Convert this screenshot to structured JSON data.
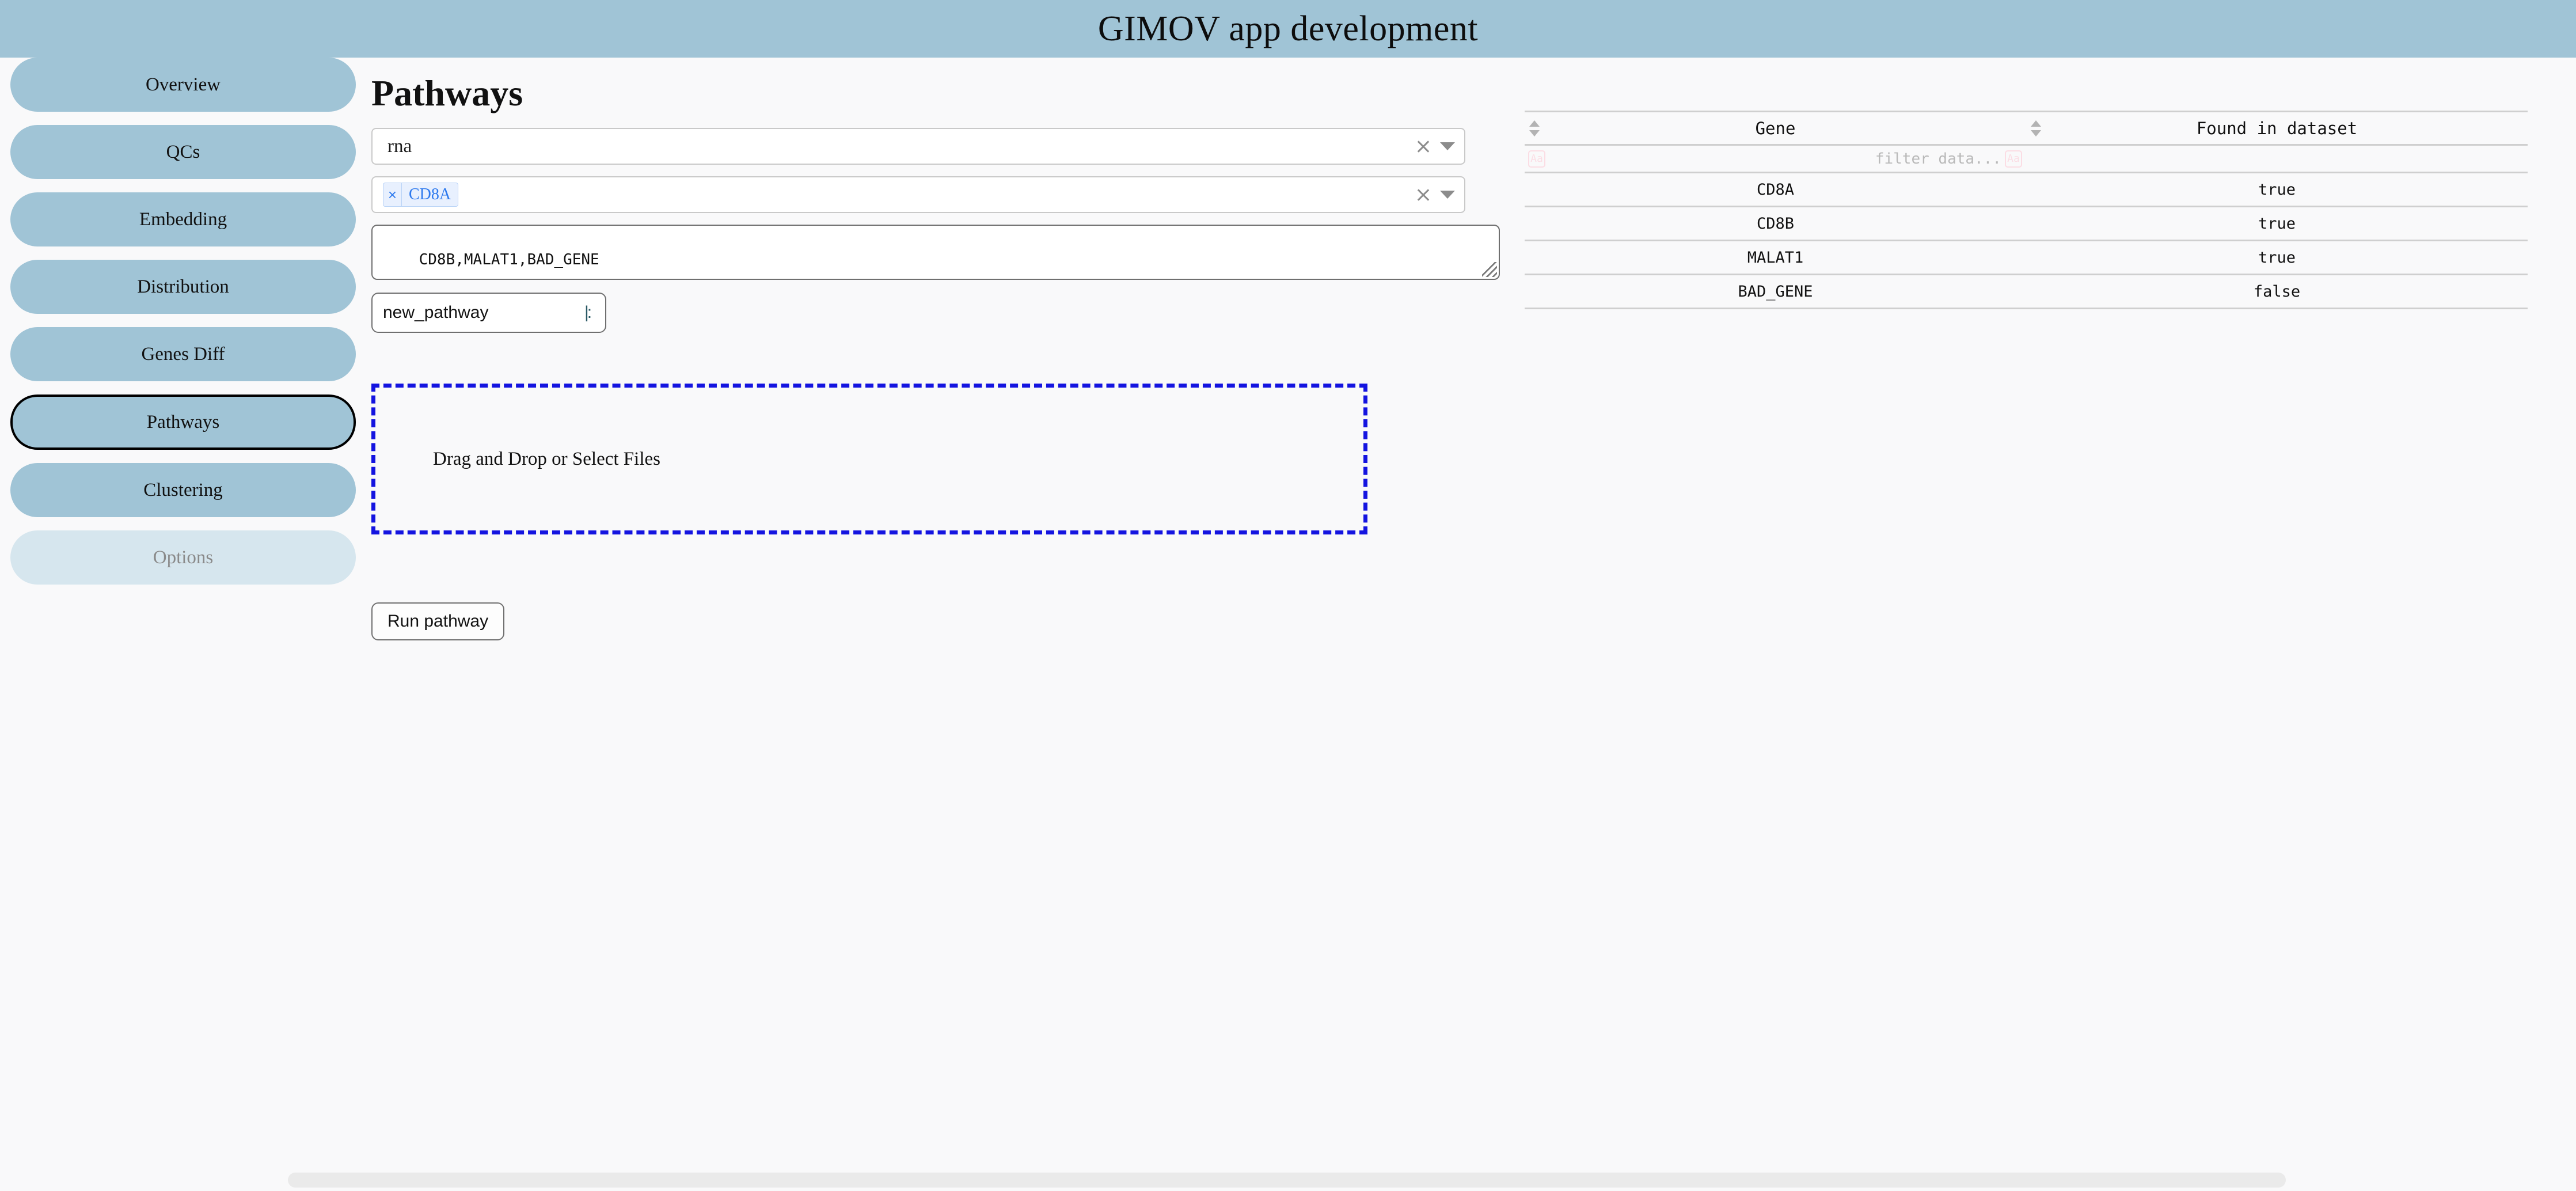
{
  "header": {
    "title": "GIMOV app development",
    "bar_color": "#a0c4d6"
  },
  "sidebar": {
    "items": [
      {
        "label": "Overview",
        "state": "normal"
      },
      {
        "label": "QCs",
        "state": "normal"
      },
      {
        "label": "Embedding",
        "state": "normal"
      },
      {
        "label": "Distribution",
        "state": "normal"
      },
      {
        "label": "Genes Diff",
        "state": "normal"
      },
      {
        "label": "Pathways",
        "state": "active"
      },
      {
        "label": "Clustering",
        "state": "normal"
      },
      {
        "label": "Options",
        "state": "disabled"
      }
    ]
  },
  "main": {
    "page_title": "Pathways",
    "modality_select": {
      "value": "rna",
      "clear_icon": "close-icon",
      "toggle_icon": "chevron-down-icon"
    },
    "genes_select": {
      "tokens": [
        {
          "label": "CD8A",
          "remove_icon": "close-icon"
        }
      ],
      "clear_icon": "close-icon",
      "toggle_icon": "chevron-down-icon"
    },
    "genes_textarea": {
      "value": "CD8B,MALAT1,BAD_GENE"
    },
    "pathway_name": {
      "value": "new_pathway",
      "caret": "|:"
    },
    "dropzone": {
      "label": "Drag and Drop or Select Files",
      "border_color": "#1414e0"
    },
    "run_button": {
      "label": "Run pathway"
    }
  },
  "table": {
    "columns": [
      {
        "label": "Gene",
        "sort_icon": "sort-icon"
      },
      {
        "label": "Found in dataset",
        "sort_icon": "sort-icon"
      }
    ],
    "filter": {
      "placeholder": "filter data...",
      "mode_icon": "case-sensitivity-icon",
      "mode_icon_label": "Aa"
    },
    "rows": [
      {
        "gene": "CD8A",
        "found": "true"
      },
      {
        "gene": "CD8B",
        "found": "true"
      },
      {
        "gene": "MALAT1",
        "found": "true"
      },
      {
        "gene": "BAD_GENE",
        "found": "false"
      }
    ]
  }
}
